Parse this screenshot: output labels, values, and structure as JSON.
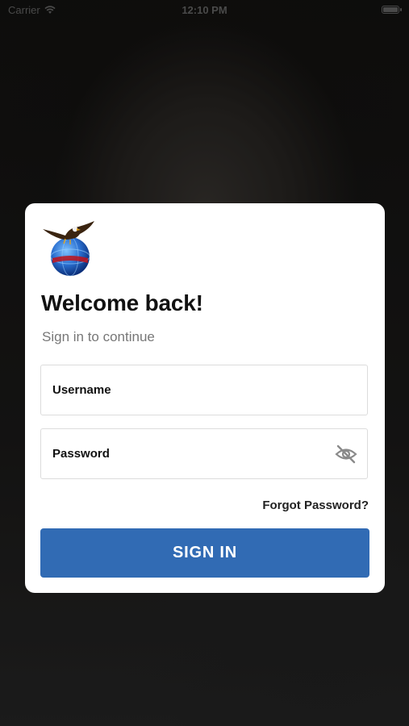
{
  "status_bar": {
    "carrier": "Carrier",
    "time": "12:10 PM",
    "icons": [
      "wifi-icon",
      "battery-icon"
    ]
  },
  "login": {
    "logo_icon": "eagle-globe-logo",
    "title": "Welcome back!",
    "subtitle": "Sign in to continue",
    "username_placeholder": "Username",
    "password_placeholder": "Password",
    "password_toggle_icon": "eye-slash-icon",
    "forgot_password": "Forgot Password?",
    "signin_label": "SIGN IN"
  },
  "colors": {
    "accent": "#316bb4",
    "card_bg": "#ffffff",
    "subtitle": "#777777"
  }
}
